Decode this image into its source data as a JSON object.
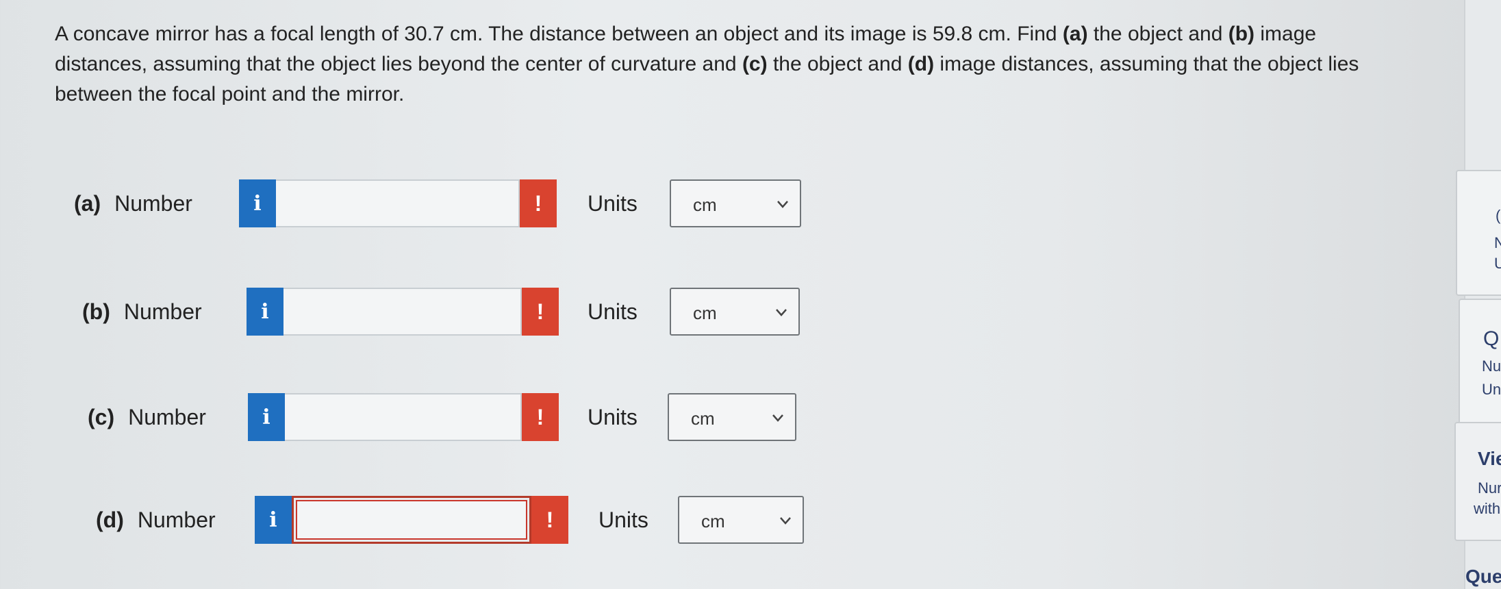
{
  "question": {
    "seg1": "A concave mirror has a focal length of 30.7 cm. The distance between an object and its image is 59.8 cm. Find ",
    "a": "(a)",
    "seg2": " the object and ",
    "b": "(b)",
    "seg3": " image distances, assuming that the object lies beyond the center of curvature and ",
    "c": "(c)",
    "seg4": " the object and ",
    "d": "(d)",
    "seg5": " image distances, assuming that the object lies between the focal point and the mirror."
  },
  "rows": [
    {
      "letter": "(a)",
      "label": "Number",
      "value": "",
      "units_label": "Units",
      "unit": "cm"
    },
    {
      "letter": "(b)",
      "label": "Number",
      "value": "",
      "units_label": "Units",
      "unit": "cm"
    },
    {
      "letter": "(c)",
      "label": "Number",
      "value": "",
      "units_label": "Units",
      "unit": "cm"
    },
    {
      "letter": "(d)",
      "label": "Number",
      "value": "",
      "units_label": "Units",
      "unit": "cm"
    }
  ],
  "info_glyph": "i",
  "warn_glyph": "!",
  "side": {
    "t1": "(",
    "t2": "N",
    "t3": "U",
    "t4": "Q",
    "t5": "Nu",
    "t6": "Un",
    "t7": "Vie",
    "t8": "Nur",
    "t9": "with",
    "t10": "Que"
  },
  "colors": {
    "info": "#1f6fc0",
    "warn": "#d9432f",
    "active_border": "#c9372c"
  }
}
